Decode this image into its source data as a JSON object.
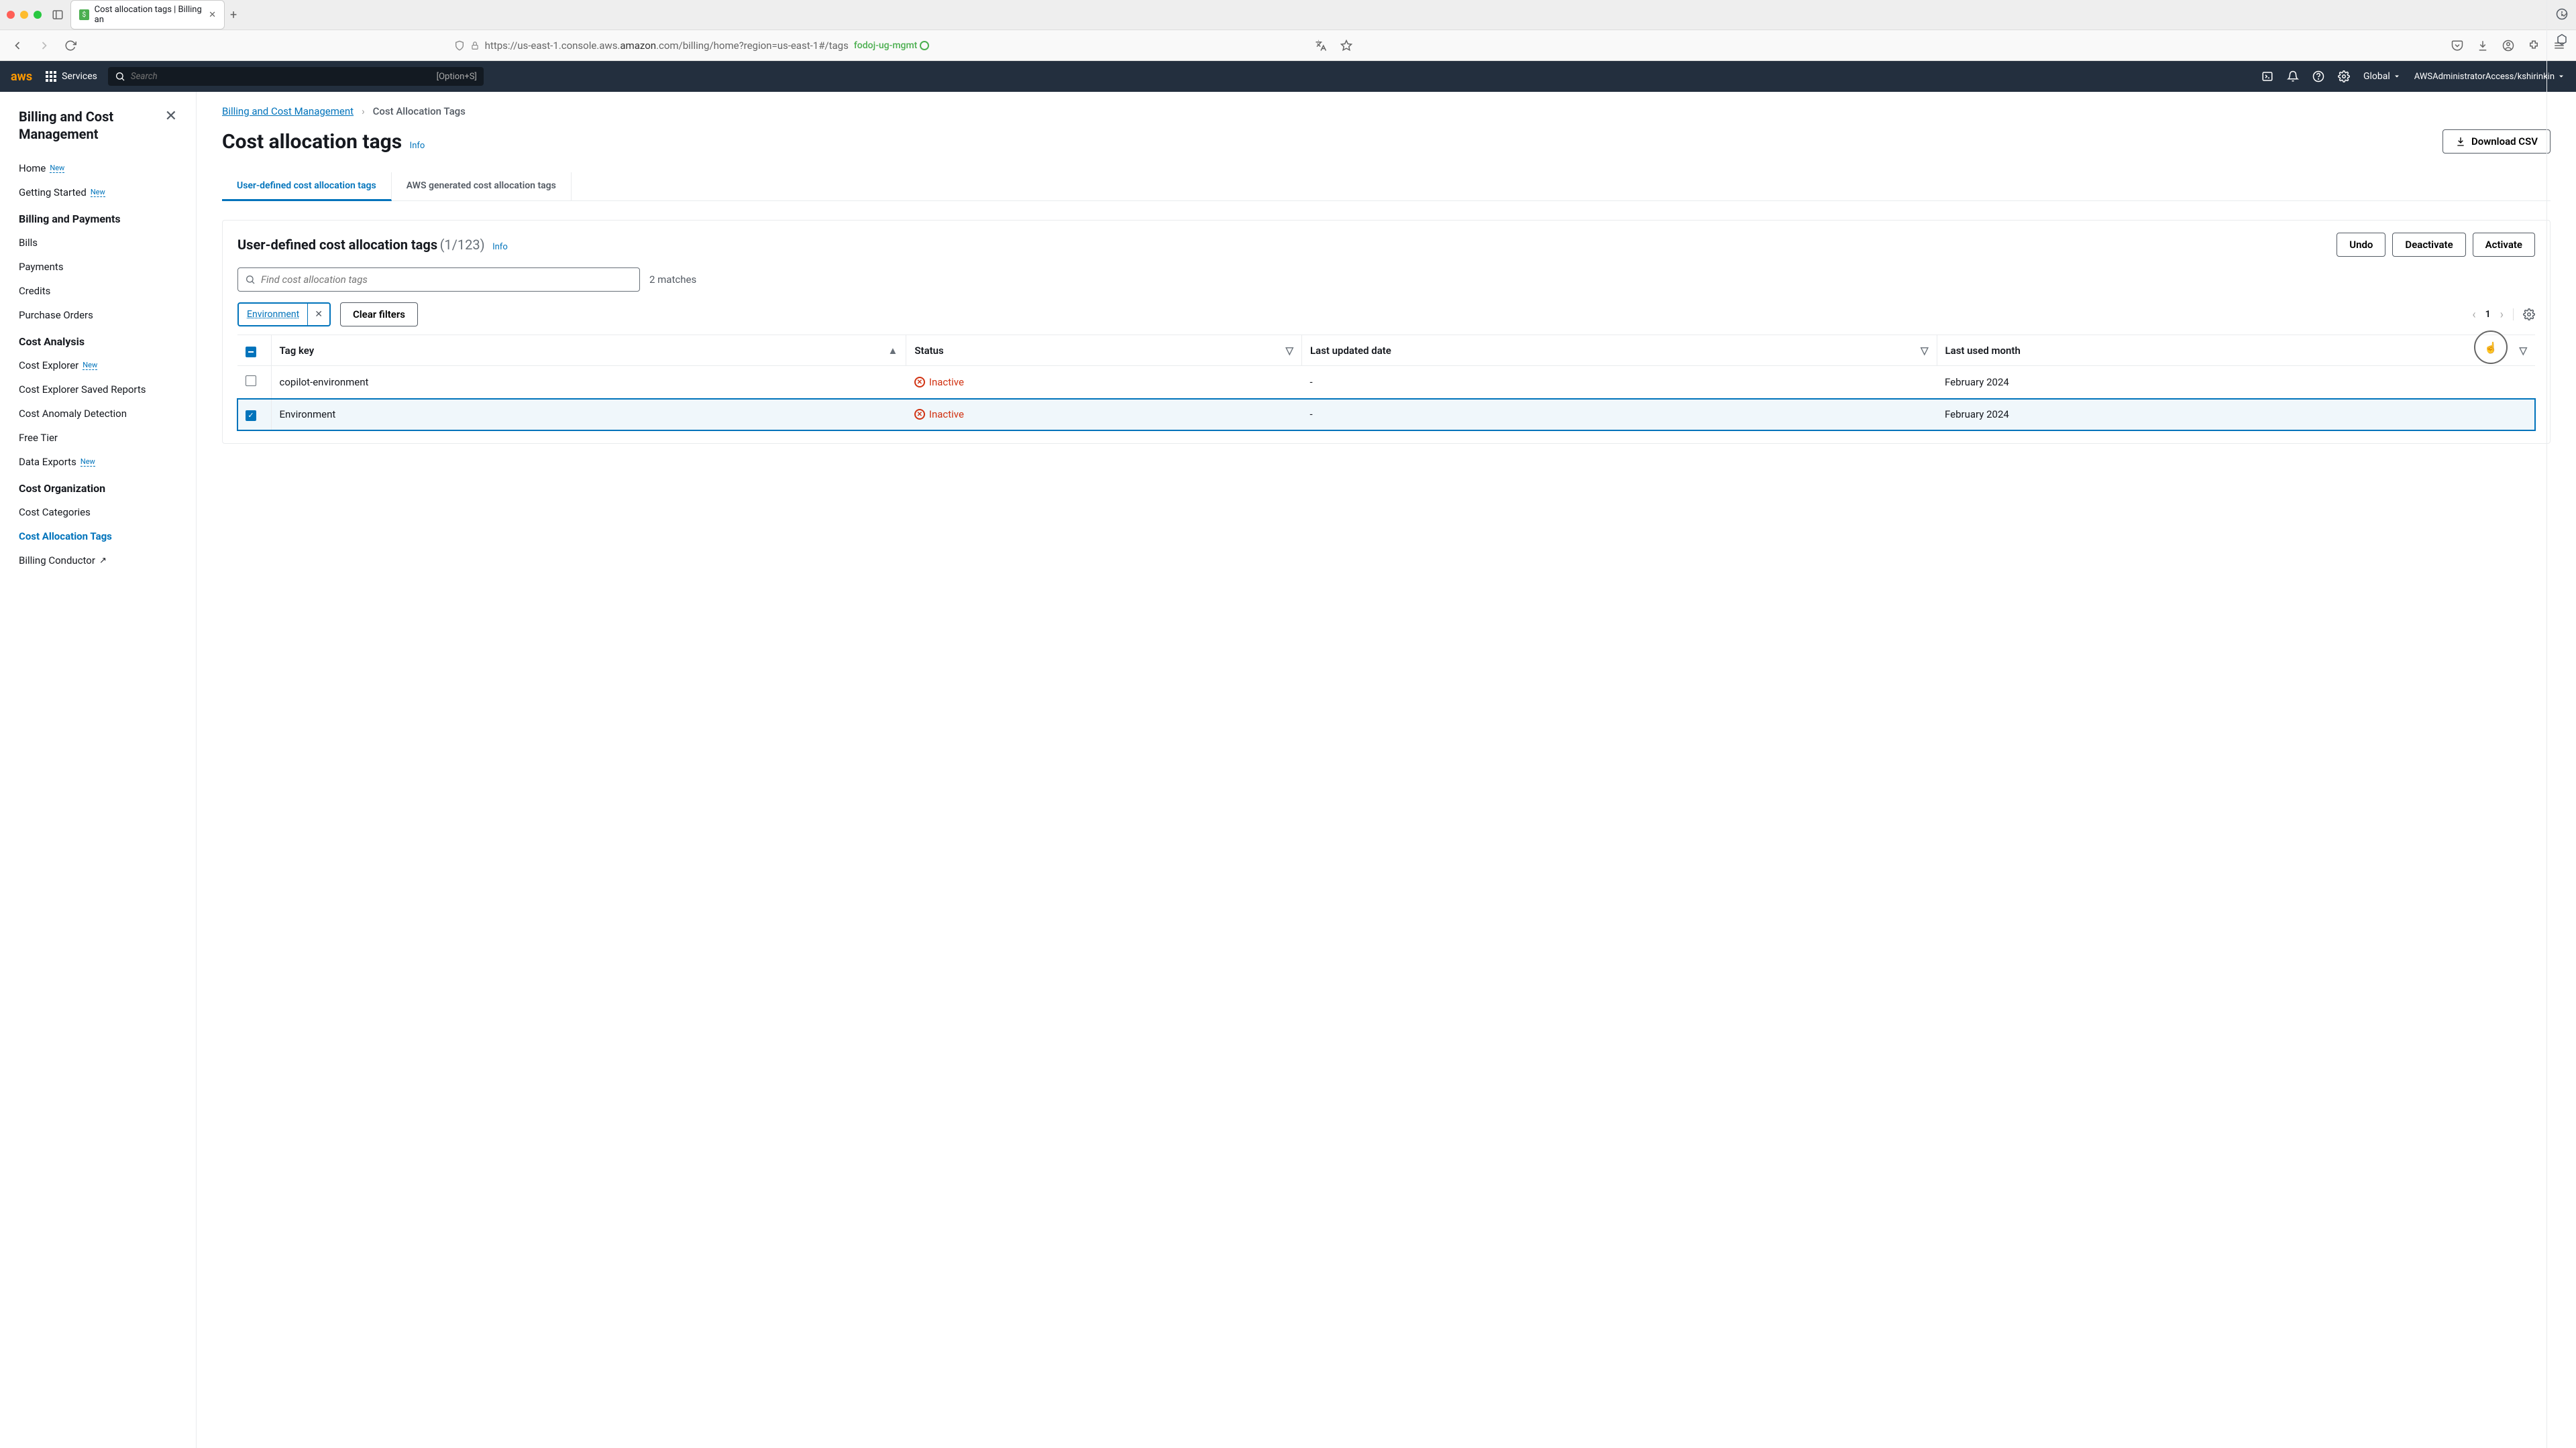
{
  "browser": {
    "tab_title": "Cost allocation tags | Billing an",
    "url_prefix": "https://us-east-1.console.aws.",
    "url_domain": "amazon",
    "url_suffix": ".com/billing/home?region=us-east-1#/tags",
    "profile": "fodoj-ug-mgmt"
  },
  "aws_top": {
    "services": "Services",
    "search_placeholder": "Search",
    "shortcut": "[Option+S]",
    "region": "Global",
    "account": "AWSAdministratorAccess/kshirinkin"
  },
  "sidebar": {
    "title": "Billing and Cost Management",
    "items": [
      {
        "label": "Home",
        "badge": "New"
      },
      {
        "label": "Getting Started",
        "badge": "New"
      }
    ],
    "sections": [
      {
        "title": "Billing and Payments",
        "items": [
          {
            "label": "Bills"
          },
          {
            "label": "Payments"
          },
          {
            "label": "Credits"
          },
          {
            "label": "Purchase Orders"
          }
        ]
      },
      {
        "title": "Cost Analysis",
        "items": [
          {
            "label": "Cost Explorer",
            "badge": "New"
          },
          {
            "label": "Cost Explorer Saved Reports"
          },
          {
            "label": "Cost Anomaly Detection"
          },
          {
            "label": "Free Tier"
          },
          {
            "label": "Data Exports",
            "badge": "New"
          }
        ]
      },
      {
        "title": "Cost Organization",
        "items": [
          {
            "label": "Cost Categories"
          },
          {
            "label": "Cost Allocation Tags",
            "active": true
          },
          {
            "label": "Billing Conductor",
            "external": true
          }
        ]
      }
    ]
  },
  "breadcrumb": {
    "root": "Billing and Cost Management",
    "current": "Cost Allocation Tags"
  },
  "page": {
    "title": "Cost allocation tags",
    "info": "Info",
    "download": "Download CSV"
  },
  "tabs": {
    "user": "User-defined cost allocation tags",
    "aws": "AWS generated cost allocation tags"
  },
  "panel": {
    "title": "User-defined cost allocation tags",
    "count": "(1/123)",
    "info": "Info",
    "undo": "Undo",
    "deactivate": "Deactivate",
    "activate": "Activate",
    "search_placeholder": "Find cost allocation tags",
    "matches": "2 matches",
    "chip": "Environment",
    "clear": "Clear filters",
    "page": "1"
  },
  "table": {
    "headers": {
      "key": "Tag key",
      "status": "Status",
      "updated": "Last updated date",
      "used": "Last used month"
    },
    "rows": [
      {
        "selected": false,
        "key": "copilot-environment",
        "status": "Inactive",
        "updated": "-",
        "used": "February 2024"
      },
      {
        "selected": true,
        "key": "Environment",
        "status": "Inactive",
        "updated": "-",
        "used": "February 2024"
      }
    ]
  }
}
